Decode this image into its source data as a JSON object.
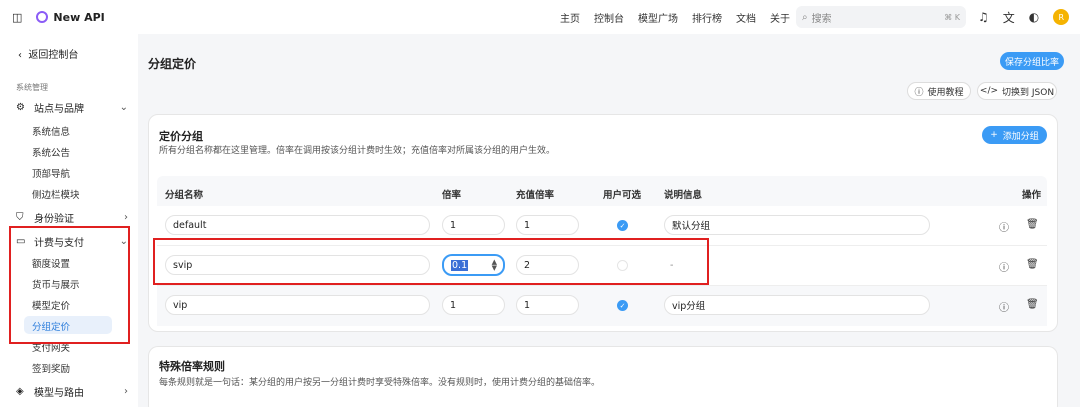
{
  "header": {
    "app_name": "New API",
    "nav": [
      "主页",
      "控制台",
      "模型广场",
      "排行榜",
      "文档",
      "关于"
    ],
    "search_placeholder": "搜索",
    "search_kbd": "⌘ K",
    "avatar_letter": "R"
  },
  "sidebar": {
    "back": "返回控制台",
    "section": "系统管理",
    "groups": [
      {
        "label": "站点与品牌",
        "icon": "gear-icon"
      },
      {
        "label": "身份验证",
        "icon": "shield-icon"
      },
      {
        "label": "计费与支付",
        "icon": "card-icon"
      },
      {
        "label": "模型与路由",
        "icon": "cube-icon"
      }
    ],
    "site_items": [
      "系统信息",
      "系统公告",
      "顶部导航",
      "侧边栏模块"
    ],
    "billing_items": [
      "额度设置",
      "货币与展示",
      "模型定价",
      "分组定价",
      "支付网关",
      "签到奖励"
    ]
  },
  "main": {
    "title": "分组定价",
    "save_button": "保存分组比率",
    "tutorial_button": "使用教程",
    "json_button": "切换到 JSON",
    "pricing_group": {
      "title": "定价分组",
      "desc": "所有分组名称都在这里管理。倍率在调用按该分组计费时生效；充值倍率对所属该分组的用户生效。",
      "add_button": "添加分组",
      "columns": [
        "分组名称",
        "倍率",
        "充值倍率",
        "用户可选",
        "说明信息",
        "操作"
      ],
      "rows": [
        {
          "name": "default",
          "ratio": "1",
          "topup": "1",
          "selectable": true,
          "desc": "默认分组"
        },
        {
          "name": "svip",
          "ratio": "0.1",
          "topup": "2",
          "selectable": false,
          "desc": "-"
        },
        {
          "name": "vip",
          "ratio": "1",
          "topup": "1",
          "selectable": true,
          "desc": "vip分组"
        }
      ]
    },
    "special": {
      "title": "特殊倍率规则",
      "desc": "每条规则就是一句话：某分组的用户按另一分组计费时享受特殊倍率。没有规则时，使用计费分组的基础倍率。"
    }
  },
  "colors": {
    "accent": "#3b9bf5",
    "highlight": "#e02020",
    "active_bg": "#e8f0fb"
  }
}
